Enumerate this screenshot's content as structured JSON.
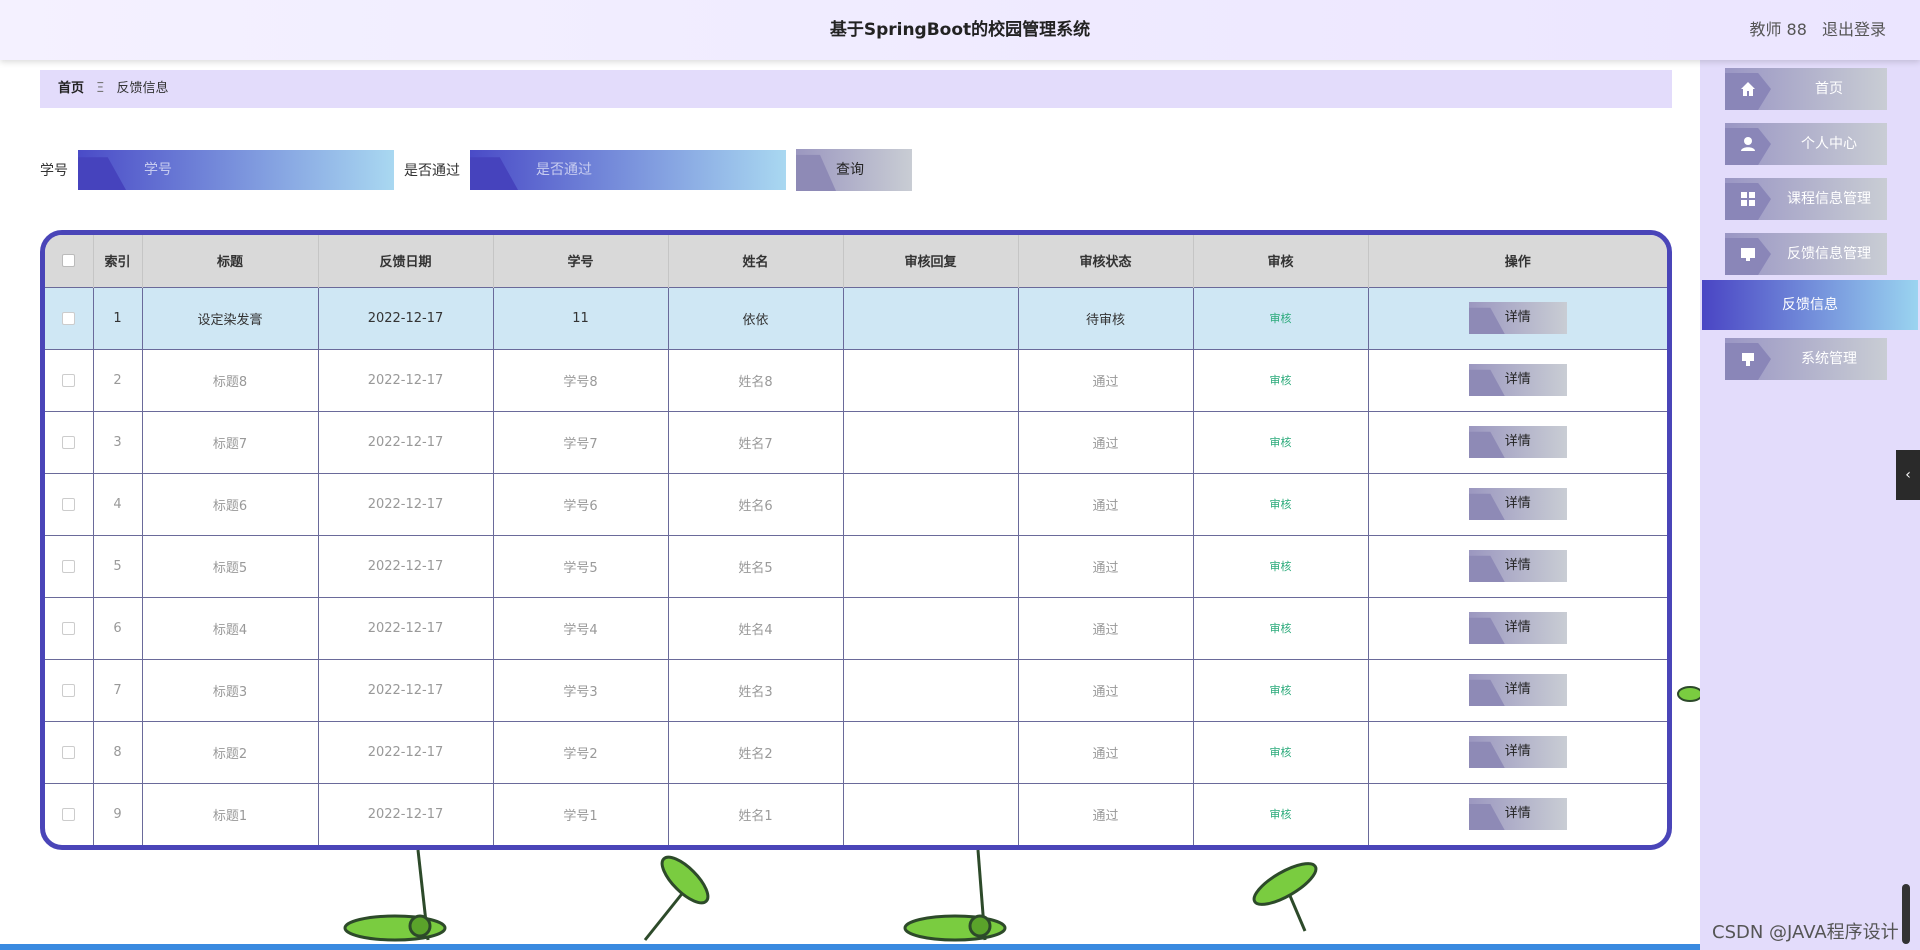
{
  "header": {
    "title": "基于SpringBoot的校园管理系统",
    "user": "教师 88",
    "logout": "退出登录"
  },
  "breadcrumb": {
    "home": "首页",
    "separator": "Ξ",
    "current": "反馈信息"
  },
  "search": {
    "student_id_label": "学号",
    "student_id_placeholder": "学号",
    "passed_label": "是否通过",
    "passed_placeholder": "是否通过",
    "query_button": "查询"
  },
  "table": {
    "headers": [
      "索引",
      "标题",
      "反馈日期",
      "学号",
      "姓名",
      "审核回复",
      "审核状态",
      "审核",
      "操作"
    ],
    "rows": [
      {
        "index": "1",
        "title": "设定染发膏",
        "date": "2022-12-17",
        "student_id": "11",
        "name": "依依",
        "reply": "",
        "status": "待审核",
        "audit": "审核",
        "action": "详情"
      },
      {
        "index": "2",
        "title": "标题8",
        "date": "2022-12-17",
        "student_id": "学号8",
        "name": "姓名8",
        "reply": "",
        "status": "通过",
        "audit": "审核",
        "action": "详情"
      },
      {
        "index": "3",
        "title": "标题7",
        "date": "2022-12-17",
        "student_id": "学号7",
        "name": "姓名7",
        "reply": "",
        "status": "通过",
        "audit": "审核",
        "action": "详情"
      },
      {
        "index": "4",
        "title": "标题6",
        "date": "2022-12-17",
        "student_id": "学号6",
        "name": "姓名6",
        "reply": "",
        "status": "通过",
        "audit": "审核",
        "action": "详情"
      },
      {
        "index": "5",
        "title": "标题5",
        "date": "2022-12-17",
        "student_id": "学号5",
        "name": "姓名5",
        "reply": "",
        "status": "通过",
        "audit": "审核",
        "action": "详情"
      },
      {
        "index": "6",
        "title": "标题4",
        "date": "2022-12-17",
        "student_id": "学号4",
        "name": "姓名4",
        "reply": "",
        "status": "通过",
        "audit": "审核",
        "action": "详情"
      },
      {
        "index": "7",
        "title": "标题3",
        "date": "2022-12-17",
        "student_id": "学号3",
        "name": "姓名3",
        "reply": "",
        "status": "通过",
        "audit": "审核",
        "action": "详情"
      },
      {
        "index": "8",
        "title": "标题2",
        "date": "2022-12-17",
        "student_id": "学号2",
        "name": "姓名2",
        "reply": "",
        "status": "通过",
        "audit": "审核",
        "action": "详情"
      },
      {
        "index": "9",
        "title": "标题1",
        "date": "2022-12-17",
        "student_id": "学号1",
        "name": "姓名1",
        "reply": "",
        "status": "通过",
        "audit": "审核",
        "action": "详情"
      }
    ]
  },
  "sidebar": {
    "items": [
      {
        "label": "首页",
        "icon": "home-icon"
      },
      {
        "label": "个人中心",
        "icon": "user-icon"
      },
      {
        "label": "课程信息管理",
        "icon": "grid-icon"
      },
      {
        "label": "反馈信息管理",
        "icon": "monitor-icon"
      },
      {
        "label": "系统管理",
        "icon": "system-icon"
      }
    ],
    "active_sub": "反馈信息"
  },
  "watermark": "CSDN @JAVA程序设计",
  "colors": {
    "accent": "#4a45b8",
    "header_bg": "#ebe5ff",
    "sidebar_bg": "#e3dcfb",
    "audit_green": "#2aaa7a"
  }
}
